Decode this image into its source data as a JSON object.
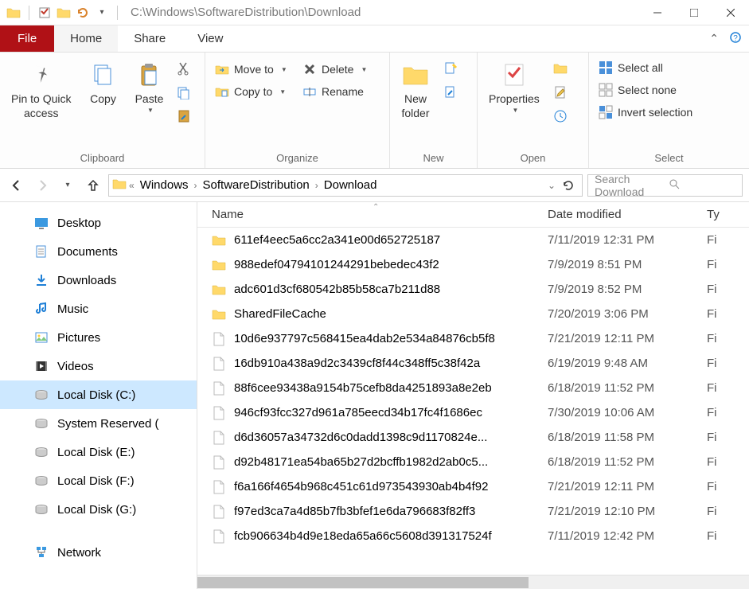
{
  "titlebar": {
    "path": "C:\\Windows\\SoftwareDistribution\\Download"
  },
  "tabs": {
    "file": "File",
    "home": "Home",
    "share": "Share",
    "view": "View"
  },
  "ribbon": {
    "clipboard": {
      "label": "Clipboard",
      "pin": "Pin to Quick\naccess",
      "copy": "Copy",
      "paste": "Paste"
    },
    "organize": {
      "label": "Organize",
      "moveto": "Move to",
      "copyto": "Copy to",
      "delete": "Delete",
      "rename": "Rename"
    },
    "new": {
      "label": "New",
      "newfolder": "New\nfolder"
    },
    "open": {
      "label": "Open",
      "properties": "Properties"
    },
    "select": {
      "label": "Select",
      "all": "Select all",
      "none": "Select none",
      "invert": "Invert selection"
    }
  },
  "breadcrumb": {
    "items": [
      "Windows",
      "SoftwareDistribution",
      "Download"
    ]
  },
  "search": {
    "placeholder": "Search Download"
  },
  "columns": {
    "name": "Name",
    "date": "Date modified",
    "type": "Ty"
  },
  "nav": {
    "items": [
      {
        "label": "Desktop",
        "icon": "desktop"
      },
      {
        "label": "Documents",
        "icon": "documents"
      },
      {
        "label": "Downloads",
        "icon": "downloads"
      },
      {
        "label": "Music",
        "icon": "music"
      },
      {
        "label": "Pictures",
        "icon": "pictures"
      },
      {
        "label": "Videos",
        "icon": "videos"
      },
      {
        "label": "Local Disk (C:)",
        "icon": "disk",
        "selected": true
      },
      {
        "label": "System Reserved (",
        "icon": "disk"
      },
      {
        "label": "Local Disk (E:)",
        "icon": "disk"
      },
      {
        "label": "Local Disk (F:)",
        "icon": "disk"
      },
      {
        "label": "Local Disk (G:)",
        "icon": "disk"
      }
    ],
    "network": "Network"
  },
  "files": [
    {
      "name": "611ef4eec5a6cc2a341e00d652725187",
      "date": "7/11/2019 12:31 PM",
      "type": "Fi",
      "kind": "folder"
    },
    {
      "name": "988edef04794101244291bebedec43f2",
      "date": "7/9/2019 8:51 PM",
      "type": "Fi",
      "kind": "folder"
    },
    {
      "name": "adc601d3cf680542b85b58ca7b211d88",
      "date": "7/9/2019 8:52 PM",
      "type": "Fi",
      "kind": "folder"
    },
    {
      "name": "SharedFileCache",
      "date": "7/20/2019 3:06 PM",
      "type": "Fi",
      "kind": "folder"
    },
    {
      "name": "10d6e937797c568415ea4dab2e534a84876cb5f8",
      "date": "7/21/2019 12:11 PM",
      "type": "Fi",
      "kind": "file"
    },
    {
      "name": "16db910a438a9d2c3439cf8f44c348ff5c38f42a",
      "date": "6/19/2019 9:48 AM",
      "type": "Fi",
      "kind": "file"
    },
    {
      "name": "88f6cee93438a9154b75cefb8da4251893a8e2eb",
      "date": "6/18/2019 11:52 PM",
      "type": "Fi",
      "kind": "file"
    },
    {
      "name": "946cf93fcc327d961a785eecd34b17fc4f1686ec",
      "date": "7/30/2019 10:06 AM",
      "type": "Fi",
      "kind": "file"
    },
    {
      "name": "d6d36057a34732d6c0dadd1398c9d1170824e...",
      "date": "6/18/2019 11:58 PM",
      "type": "Fi",
      "kind": "file"
    },
    {
      "name": "d92b48171ea54ba65b27d2bcffb1982d2ab0c5...",
      "date": "6/18/2019 11:52 PM",
      "type": "Fi",
      "kind": "file"
    },
    {
      "name": "f6a166f4654b968c451c61d973543930ab4b4f92",
      "date": "7/21/2019 12:11 PM",
      "type": "Fi",
      "kind": "file"
    },
    {
      "name": "f97ed3ca7a4d85b7fb3bfef1e6da796683f82ff3",
      "date": "7/21/2019 12:10 PM",
      "type": "Fi",
      "kind": "file"
    },
    {
      "name": "fcb906634b4d9e18eda65a66c5608d391317524f",
      "date": "7/11/2019 12:42 PM",
      "type": "Fi",
      "kind": "file"
    }
  ]
}
